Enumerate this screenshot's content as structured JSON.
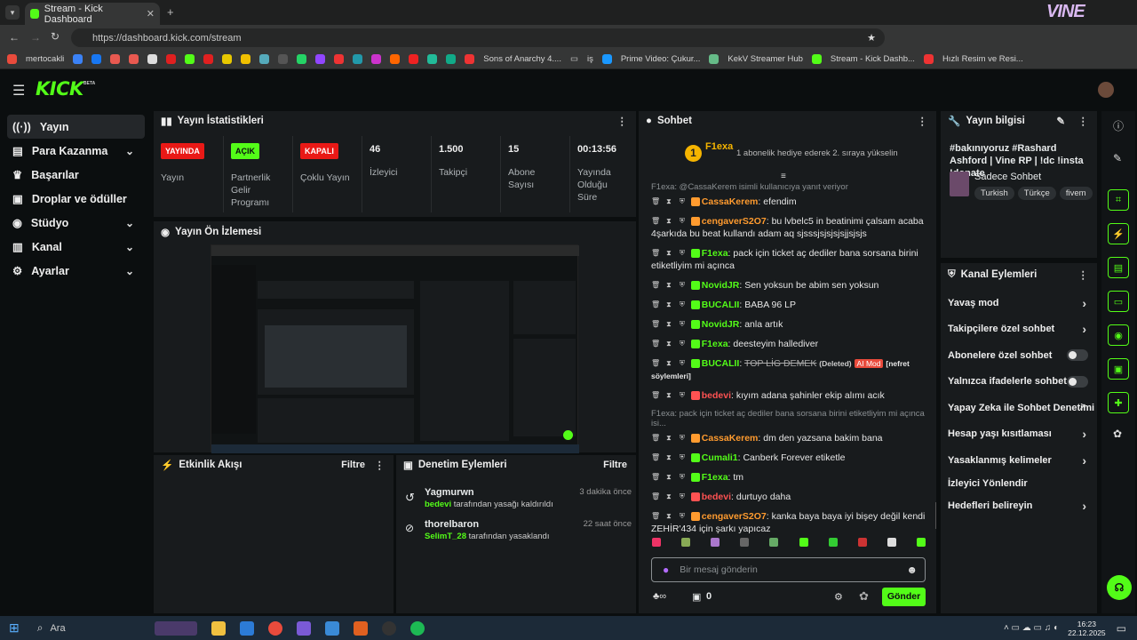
{
  "browser": {
    "tab_title": "Stream - Kick Dashboard",
    "url": "https://dashboard.kick.com/stream",
    "bookmarks": [
      "mertocakli",
      "Sons of Anarchy 4....",
      "iş",
      "Prime Video: Çukur...",
      "KekV Streamer Hub",
      "Stream - Kick Dashb...",
      "Hızlı Resim ve Resi..."
    ]
  },
  "header": {
    "logo": "KICK",
    "logo_sup": "BETA"
  },
  "sidebar": {
    "items": [
      {
        "label": "Yayın"
      },
      {
        "label": "Para Kazanma"
      },
      {
        "label": "Başarılar"
      },
      {
        "label": "Droplar ve ödüller"
      },
      {
        "label": "Stüdyo"
      },
      {
        "label": "Kanal"
      },
      {
        "label": "Ayarlar"
      }
    ]
  },
  "stats": {
    "title": "Yayın İstatistikleri",
    "items": [
      {
        "badge": "YAYINDA",
        "label": "Yayın"
      },
      {
        "badge": "AÇIK",
        "label": "Partnerlik Gelir Programı"
      },
      {
        "badge": "KAPALI",
        "label": "Çoklu Yayın"
      },
      {
        "value": "46",
        "label": "İzleyici"
      },
      {
        "value": "1.500",
        "label": "Takipçi"
      },
      {
        "value": "15",
        "label": "Abone Sayısı"
      },
      {
        "value": "00:13:56",
        "label": "Yayında Olduğu Süre"
      }
    ]
  },
  "preview": {
    "title": "Yayın Ön İzlemesi"
  },
  "activity": {
    "title": "Etkinlik Akışı",
    "filter": "Filtre"
  },
  "moderation": {
    "title": "Denetim Eylemleri",
    "filter": "Filtre",
    "items": [
      {
        "user": "Yagmurwn",
        "time": "3 dakika önce",
        "by": "bedevi",
        "text": "tarafından yasağı kaldırıldı"
      },
      {
        "user": "thorelbaron",
        "time": "22 saat önce",
        "by": "SelimT_28",
        "text": "tarafından yasaklandı"
      }
    ]
  },
  "chat": {
    "title": "Sohbet",
    "pinned_user": "F1exa",
    "pinned_text": "1 abonelik hediye ederek 2. sıraya yükselin",
    "pinned_rank": "1",
    "messages": [
      {
        "reply": "F1exa: @CassaKerem isimli kullanıcıya yanıt veriyor",
        "user": "CassaKerem",
        "color": "#ff9b2f",
        "text": "efendim"
      },
      {
        "user": "cengaverS2O7",
        "color": "#ff9b2f",
        "text": "bu lvbelc5 in beatinimi çalsam acaba 4şarkıda bu beat kullandı adam aq sjsssjsjsjsjsjjsjsjs"
      },
      {
        "user": "F1exa",
        "color": "#53fc18",
        "text": "pack için ticket aç dediler bana sorsana birini etiketliyim mi açınca"
      },
      {
        "user": "NovidJR",
        "color": "#53fc18",
        "text": "Sen yoksun be abim sen yoksun"
      },
      {
        "user": "BUCALII",
        "color": "#53fc18",
        "text": "BABA 96 LP"
      },
      {
        "user": "NovidJR",
        "color": "#53fc18",
        "text": "anla artık"
      },
      {
        "user": "F1exa",
        "color": "#53fc18",
        "text": "deesteyim hallediver"
      },
      {
        "user": "BUCALII",
        "color": "#53fc18",
        "text": "TOP LİG DEMEK",
        "deleted": "(Deleted)",
        "mod": "AI Mod",
        "reason": "[nefret söylemleri]"
      },
      {
        "user": "bedevi",
        "color": "#ff5252",
        "text": "kıyım adana şahinler ekip alımı acık"
      },
      {
        "reply": "F1exa: pack için ticket aç dediler bana sorsana birini etiketliyim mi açınca isi...",
        "user": "CassaKerem",
        "color": "#ff9b2f",
        "text": "dm den yazsana bakim bana"
      },
      {
        "user": "Cumali1",
        "color": "#53fc18",
        "text": "Canberk Forever etiketle"
      },
      {
        "user": "F1exa",
        "color": "#53fc18",
        "text": "tm"
      },
      {
        "user": "bedevi",
        "color": "#ff5252",
        "text": "durtuyo daha"
      },
      {
        "user": "cengaverS2O7",
        "color": "#ff9b2f",
        "text": "kanka baya baya iyi bişey değil kendi ZEHİR'434 için şarkı yapıcaz"
      }
    ],
    "input_placeholder": "Bir mesaj gönderin",
    "points": "0",
    "send": "Gönder"
  },
  "info": {
    "title": "Yayın bilgisi",
    "stream_title": "#bakınıyoruz #Rashard Ashford | Vine RP | !dc !insta !donate",
    "category": "Sadece Sohbet",
    "tags": [
      "Turkish",
      "Türkçe",
      "fivem"
    ]
  },
  "actions": {
    "title": "Kanal Eylemleri",
    "items": [
      {
        "label": "Yavaş mod",
        "kind": "chev"
      },
      {
        "label": "Takipçilere özel sohbet",
        "kind": "chev"
      },
      {
        "label": "Abonelere özel sohbet",
        "kind": "toggle"
      },
      {
        "label": "Yalnızca ifadelerle sohbet",
        "kind": "toggle"
      },
      {
        "label": "Yapay Zeka ile Sohbet Denetimi",
        "kind": "ext"
      },
      {
        "label": "Hesap yaşı kısıtlaması",
        "kind": "chev"
      },
      {
        "label": "Yasaklanmış kelimeler",
        "kind": "chev"
      },
      {
        "label": "İzleyici Yönlendir",
        "kind": "none"
      },
      {
        "label": "Hedefleri belireyin",
        "kind": "chev"
      }
    ]
  },
  "taskbar": {
    "search": "Ara",
    "time": "16:23",
    "date": "22.12.2025"
  },
  "colors": {
    "accent": "#53fc18",
    "live": "#e91916",
    "panel": "#181b1d",
    "bg": "#0b0e0f"
  }
}
